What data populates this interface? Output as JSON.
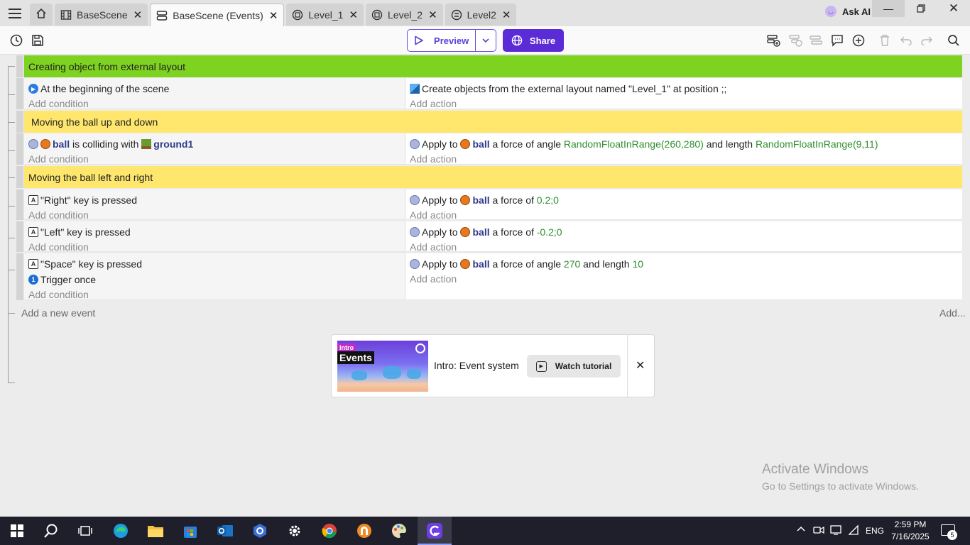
{
  "tabs": [
    {
      "label": "BaseScene",
      "icon": "scene-film-icon"
    },
    {
      "label": "BaseScene (Events)",
      "icon": "events-list-icon",
      "active": true
    },
    {
      "label": "Level_1",
      "icon": "external-layout-icon"
    },
    {
      "label": "Level_2",
      "icon": "external-layout-icon"
    },
    {
      "label": "Level2",
      "icon": "external-events-icon"
    }
  ],
  "header": {
    "ask_ai": "Ask AI"
  },
  "toolbar": {
    "preview": "Preview",
    "share": "Share"
  },
  "events": {
    "comment1": "Creating object from external layout",
    "e1_cond": "At the beginning of the scene",
    "e1_act_a": "Create objects from the external layout named \"Level_1\" at position ;;",
    "comment2": "Moving the ball up and down",
    "e2_cond_obj": "ball",
    "e2_cond_mid": "is colliding with",
    "e2_cond_obj2": "ground1",
    "e2_act_pre": "Apply to",
    "e2_act_obj": "ball",
    "e2_act_mid": "a force of angle",
    "e2_act_v1": "RandomFloatInRange(260,280)",
    "e2_act_mid2": "and length",
    "e2_act_v2": "RandomFloatInRange(9,11)",
    "comment3": "Moving the ball left and right",
    "e3_cond": "\"Right\" key is pressed",
    "e3_act_pre": "Apply to",
    "e3_act_obj": "ball",
    "e3_act_mid": "a force of",
    "e3_act_v": "0.2;0",
    "e4_cond": "\"Left\" key is pressed",
    "e4_act_pre": "Apply to",
    "e4_act_obj": "ball",
    "e4_act_mid": "a force of",
    "e4_act_v": "-0.2;0",
    "e5_cond1": "\"Space\" key is pressed",
    "e5_cond2": "Trigger once",
    "e5_act_pre": "Apply to",
    "e5_act_obj": "ball",
    "e5_act_mid": "a force of angle",
    "e5_act_v1": "270",
    "e5_act_mid2": "and length",
    "e5_act_v2": "10",
    "add_condition": "Add condition",
    "add_action": "Add action",
    "add_event": "Add a new event",
    "add_more": "Add..."
  },
  "tutorial": {
    "thumb_tag": "Intro",
    "thumb_title": "Events",
    "title": "Intro: Event system",
    "watch": "Watch tutorial"
  },
  "watermark": {
    "line1": "Activate Windows",
    "line2": "Go to Settings to activate Windows."
  },
  "taskbar": {
    "lang": "ENG",
    "time": "2:59 PM",
    "date": "7/16/2025",
    "notifications": "5"
  },
  "colors": {
    "accent": "#5b2bd6",
    "comment_green": "#7ed321",
    "comment_yellow": "#ffe66d",
    "value_green": "#2f8f2f",
    "object_blue": "#2d3a8c"
  }
}
